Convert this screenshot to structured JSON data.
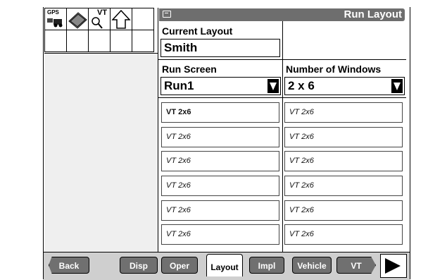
{
  "header": {
    "title": "Run Layout"
  },
  "iconbar": {
    "gps_label": "GPS",
    "vt_label": "VT"
  },
  "current_layout": {
    "label": "Current Layout",
    "value": "Smith"
  },
  "run_screen": {
    "label": "Run Screen",
    "value": "Run1"
  },
  "num_windows": {
    "label": "Number of Windows",
    "value": "2 x 6"
  },
  "windows": [
    [
      "VT 2x6",
      "VT 2x6"
    ],
    [
      "VT 2x6",
      "VT 2x6"
    ],
    [
      "VT 2x6",
      "VT 2x6"
    ],
    [
      "VT 2x6",
      "VT 2x6"
    ],
    [
      "VT 2x6",
      "VT 2x6"
    ],
    [
      "VT 2x6",
      "VT 2x6"
    ]
  ],
  "nav": {
    "back": "Back",
    "disp": "Disp",
    "oper": "Oper",
    "layout": "Layout",
    "impl": "Impl",
    "vehicle": "Vehicle",
    "vt": "VT",
    "active": "Layout"
  }
}
